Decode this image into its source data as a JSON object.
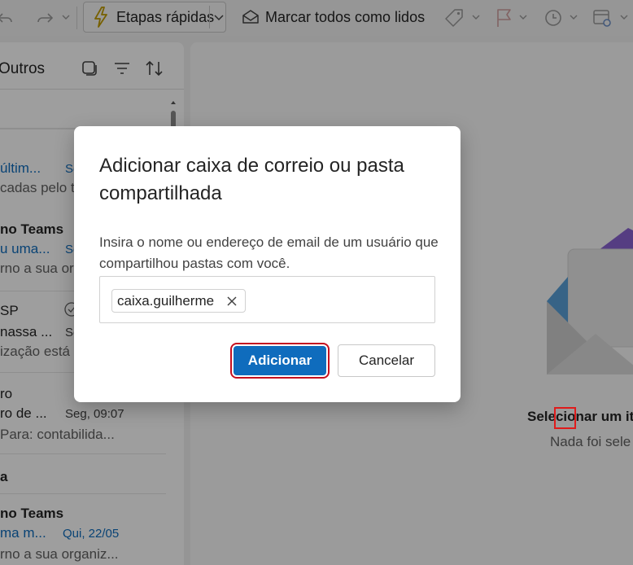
{
  "toolbar": {
    "quick_steps_label": "Etapas rápidas",
    "mark_all_read_label": "Marcar todos como lidos"
  },
  "list": {
    "folder_title": "Outros",
    "messages": [
      {
        "subject": "últim...",
        "time": "Se",
        "preview": "cadas pelo t"
      },
      {
        "sender": "no Teams",
        "subject": "u uma...",
        "time": "Se",
        "preview": "rno a sua or"
      },
      {
        "sender": "SP",
        "subject": "nassa ...",
        "time": "Se",
        "preview": "ização está"
      },
      {
        "sender": "ro",
        "subject": "ro de ...",
        "time": "Seg, 09:07",
        "preview": "Para: contabilida..."
      },
      {
        "sender": "no Teams",
        "subject": "ma m...",
        "time": "Qui, 22/05",
        "preview": "rno a sua organiz..."
      }
    ],
    "section_label": "a"
  },
  "reading": {
    "empty_title": "Selecionar um it",
    "empty_subtitle": "Nada foi sele"
  },
  "dialog": {
    "title": "Adicionar caixa de correio ou pasta compartilhada",
    "description": "Insira o nome ou endereço de email de um usuário que compartilhou pastas com você.",
    "recipient_chip": "caixa.guilherme",
    "add_button": "Adicionar",
    "cancel_button": "Cancelar"
  },
  "colors": {
    "accent": "#0f6cbd",
    "highlight": "#c50f1f"
  }
}
